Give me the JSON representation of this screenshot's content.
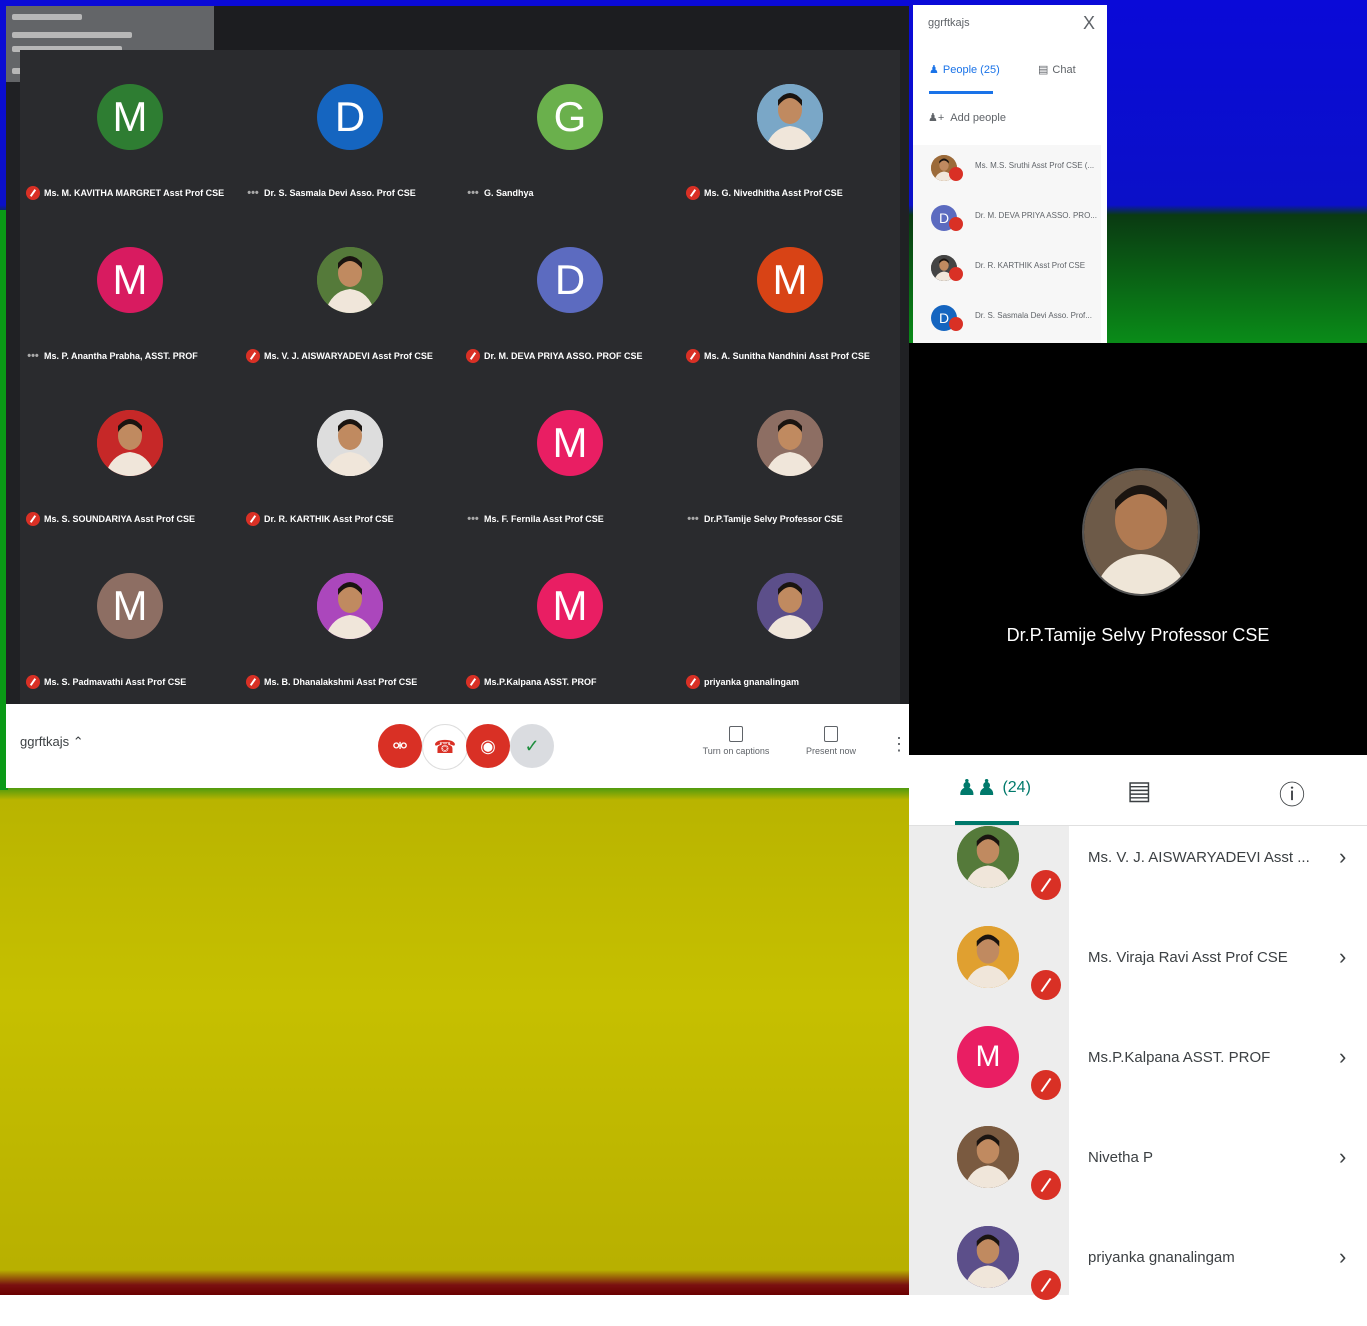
{
  "meeting_code": "ggrftkajs",
  "grid": [
    {
      "name": "Ms. M. KAVITHA MARGRET Asst Prof CSE",
      "initial": "M",
      "color": "#2e7d32",
      "muted": true,
      "photo": false
    },
    {
      "name": "Dr. S. Sasmala Devi Asso. Prof CSE",
      "initial": "D",
      "color": "#1565c0",
      "muted": false,
      "photo": false
    },
    {
      "name": "G. Sandhya",
      "initial": "G",
      "color": "#6ab04c",
      "muted": false,
      "photo": false
    },
    {
      "name": "Ms. G. Nivedhitha Asst Prof CSE",
      "initial": "",
      "color": "#7aa7c7",
      "muted": true,
      "photo": true
    },
    {
      "name": "Ms. P. Anantha Prabha, ASST. PROF",
      "initial": "M",
      "color": "#d81b60",
      "muted": false,
      "photo": false
    },
    {
      "name": "Ms. V. J. AISWARYADEVI Asst Prof CSE",
      "initial": "",
      "color": "#557a3a",
      "muted": true,
      "photo": true
    },
    {
      "name": "Dr. M. DEVA PRIYA ASSO. PROF CSE",
      "initial": "D",
      "color": "#5c6bc0",
      "muted": true,
      "photo": false
    },
    {
      "name": "Ms. A. Sunitha Nandhini Asst Prof CSE",
      "initial": "M",
      "color": "#d84315",
      "muted": true,
      "photo": false
    },
    {
      "name": "Ms. S. SOUNDARIYA Asst Prof CSE",
      "initial": "",
      "color": "#c62828",
      "muted": true,
      "photo": true
    },
    {
      "name": "Dr. R. KARTHIK Asst Prof CSE",
      "initial": "",
      "color": "#dddddd",
      "muted": true,
      "photo": true
    },
    {
      "name": "Ms. F. Fernila Asst Prof CSE",
      "initial": "M",
      "color": "#e91e63",
      "muted": false,
      "photo": false
    },
    {
      "name": "Dr.P.Tamije Selvy Professor CSE",
      "initial": "",
      "color": "#8d6e63",
      "muted": false,
      "photo": true
    },
    {
      "name": "Ms. S. Padmavathi Asst Prof CSE",
      "initial": "M",
      "color": "#8d6e63",
      "muted": true,
      "photo": false
    },
    {
      "name": "Ms. B. Dhanalakshmi Asst Prof CSE",
      "initial": "",
      "color": "#ab47bc",
      "muted": true,
      "photo": true
    },
    {
      "name": "Ms.P.Kalpana ASST. PROF",
      "initial": "M",
      "color": "#e91e63",
      "muted": true,
      "photo": false
    },
    {
      "name": "priyanka gnanalingam",
      "initial": "",
      "color": "#5c4f8a",
      "muted": true,
      "photo": true
    }
  ],
  "controls": {
    "captions": "Turn on captions",
    "present": "Present now"
  },
  "people_panel": {
    "title": "ggrftkajs",
    "close": "X",
    "tab_people": "People (25)",
    "tab_chat": "Chat",
    "add_people": "Add people",
    "list": [
      {
        "name": "Ms. M.S. Sruthi Asst Prof CSE (...",
        "initial": "",
        "color": "#9c6b3a"
      },
      {
        "name": "Dr. M. DEVA PRIYA ASSO. PRO...",
        "initial": "D",
        "color": "#5c6bc0"
      },
      {
        "name": "Dr. R. KARTHIK Asst Prof CSE",
        "initial": "",
        "color": "#444444"
      },
      {
        "name": "Dr. S. Sasmala Devi Asso. Prof...",
        "initial": "D",
        "color": "#1565c0"
      }
    ]
  },
  "presenter": {
    "name": "Dr.P.Tamije Selvy Professor CSE"
  },
  "mobile": {
    "count": "(24)",
    "rows": [
      {
        "name": "Ms. V. J. AISWARYADEVI Asst ...",
        "initial": "",
        "color": "#557a3a"
      },
      {
        "name": "Ms. Viraja Ravi Asst Prof CSE",
        "initial": "",
        "color": "#e0a030"
      },
      {
        "name": "Ms.P.Kalpana ASST. PROF",
        "initial": "M",
        "color": "#e91e63"
      },
      {
        "name": "Nivetha P",
        "initial": "",
        "color": "#7a5a40"
      },
      {
        "name": "priyanka gnanalingam",
        "initial": "",
        "color": "#5c4f8a"
      }
    ]
  }
}
